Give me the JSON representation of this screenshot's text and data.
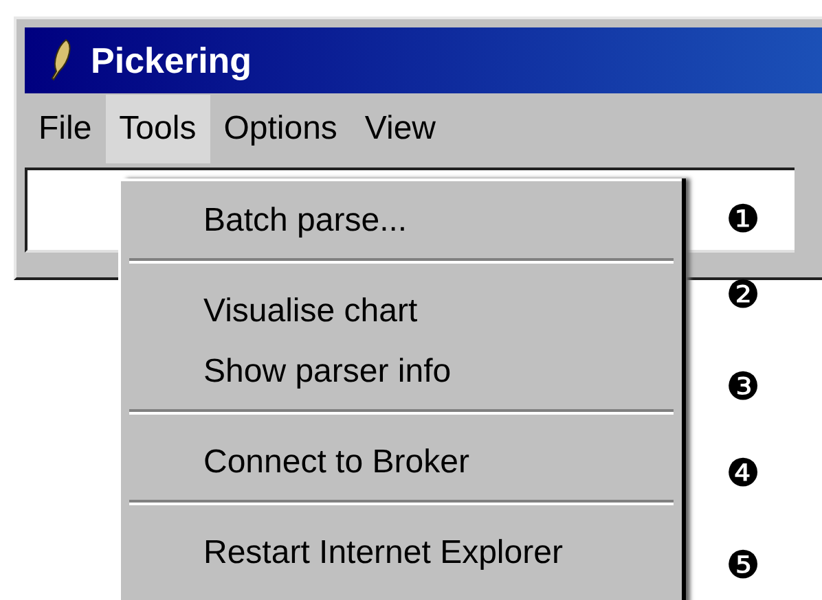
{
  "window": {
    "title": "Pickering"
  },
  "menu_bar": [
    {
      "label": "File",
      "selected": false
    },
    {
      "label": "Tools",
      "selected": true
    },
    {
      "label": "Options",
      "selected": false
    },
    {
      "label": "View",
      "selected": false
    }
  ],
  "dropdown": {
    "items": [
      {
        "kind": "item",
        "label": "Batch parse..."
      },
      {
        "kind": "separator"
      },
      {
        "kind": "item",
        "label": "Visualise chart"
      },
      {
        "kind": "item",
        "label": "Show parser info"
      },
      {
        "kind": "separator"
      },
      {
        "kind": "item",
        "label": "Connect to Broker"
      },
      {
        "kind": "separator"
      },
      {
        "kind": "item",
        "label": "Restart Internet Explorer"
      }
    ]
  },
  "callouts": [
    {
      "label": "❶"
    },
    {
      "label": "❷"
    },
    {
      "label": "❸"
    },
    {
      "label": "❹"
    },
    {
      "label": "❺"
    }
  ]
}
